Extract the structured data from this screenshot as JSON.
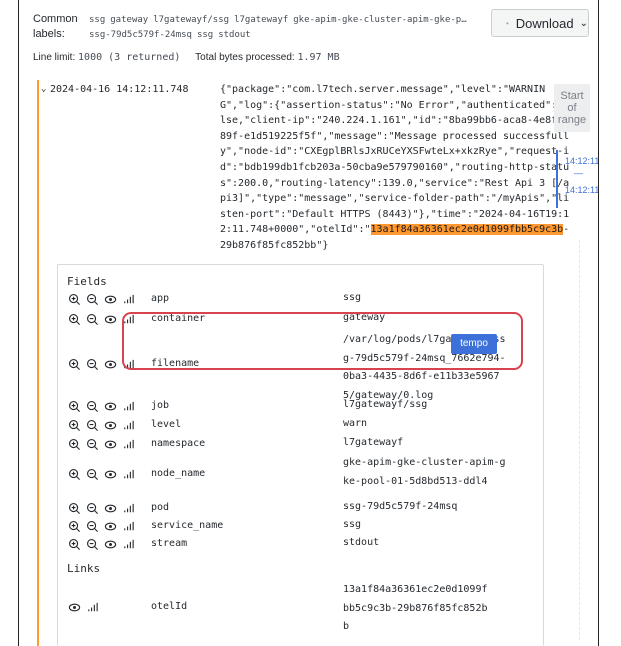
{
  "header": {
    "common_labels_title": "Common labels:",
    "labels": [
      "ssg",
      "gateway",
      "l7gatewayf/ssg",
      "l7gatewayf",
      "gke-apim-gke-cluster-apim-gke-p…",
      "ssg-79d5c579f-24msq",
      "ssg",
      "stdout"
    ],
    "download_label": "Download",
    "line_limit_label": "Line limit:",
    "line_limit_value": "1000 (3 returned)",
    "bytes_label": "Total bytes processed:",
    "bytes_value": "1.97 MB"
  },
  "log": {
    "timestamp": "2024-04-16 14:12:11.748",
    "message_before": "{\"package\":\"com.l7tech.server.message\",\"level\":\"WARNING\",\"log\":{\"assertion-status\":\"No Error\",\"authenticated\":false,\"client-ip\":\"240.224.1.161\",\"id\":\"8ba99bb6-aca8-4e8f-a89f-e1d519225f5f\",\"message\":\"Message processed successfully\",\"node-id\":\"CXEgplBRlsJxRUCeYXSFwteLx+xkzRye\",\"request-id\":\"bdb199db1fcb203a-50cba9e579790160\",\"routing-http-status\":200.0,\"routing-latency\":139.0,\"service\":\"Rest Api 3 [/api3]\",\"type\":\"message\",\"service-folder-path\":\"/myApis\",\"listen-port\":\"Default HTTPS (8443)\"},\"time\":\"2024-04-16T19:12:11.748+0000\",\"otelId\":\"",
    "message_highlight": "13a1f84a36361ec2e0d1099fbb5c9c3b",
    "message_after": "-29b876f85fc852bb\"}"
  },
  "range": {
    "label_line1": "Start",
    "label_line2": "of",
    "label_line3": "range",
    "time_start": "14:12:11",
    "dash": "—",
    "time_end": "14:12:11"
  },
  "fields_title": "Fields",
  "fields": [
    {
      "name": "app",
      "value": "ssg"
    },
    {
      "name": "container",
      "value": "gateway"
    },
    {
      "name": "filename",
      "value": "/var/log/pods/l7gatewayf_ssg-79d5c579f-24msq_7662e794-0ba3-4435-8d6f-e11b33e59675/gateway/0.log"
    },
    {
      "name": "job",
      "value": "l7gatewayf/ssg"
    },
    {
      "name": "level",
      "value": "warn"
    },
    {
      "name": "namespace",
      "value": "l7gatewayf"
    },
    {
      "name": "node_name",
      "value": "gke-apim-gke-cluster-apim-gke-pool-01-5d8bd513-ddl4"
    },
    {
      "name": "pod",
      "value": "ssg-79d5c579f-24msq"
    },
    {
      "name": "service_name",
      "value": "ssg"
    },
    {
      "name": "stream",
      "value": "stdout"
    }
  ],
  "links_title": "Links",
  "link": {
    "name": "otelId",
    "value": "13a1f84a36361ec2e0d1099fbb5c9c3b-29b876f85fc852bb",
    "button_label": "tempo"
  },
  "colors": {
    "highlight": "#ff9830",
    "accent": "#3d71d9",
    "annotation": "#d9434f"
  }
}
